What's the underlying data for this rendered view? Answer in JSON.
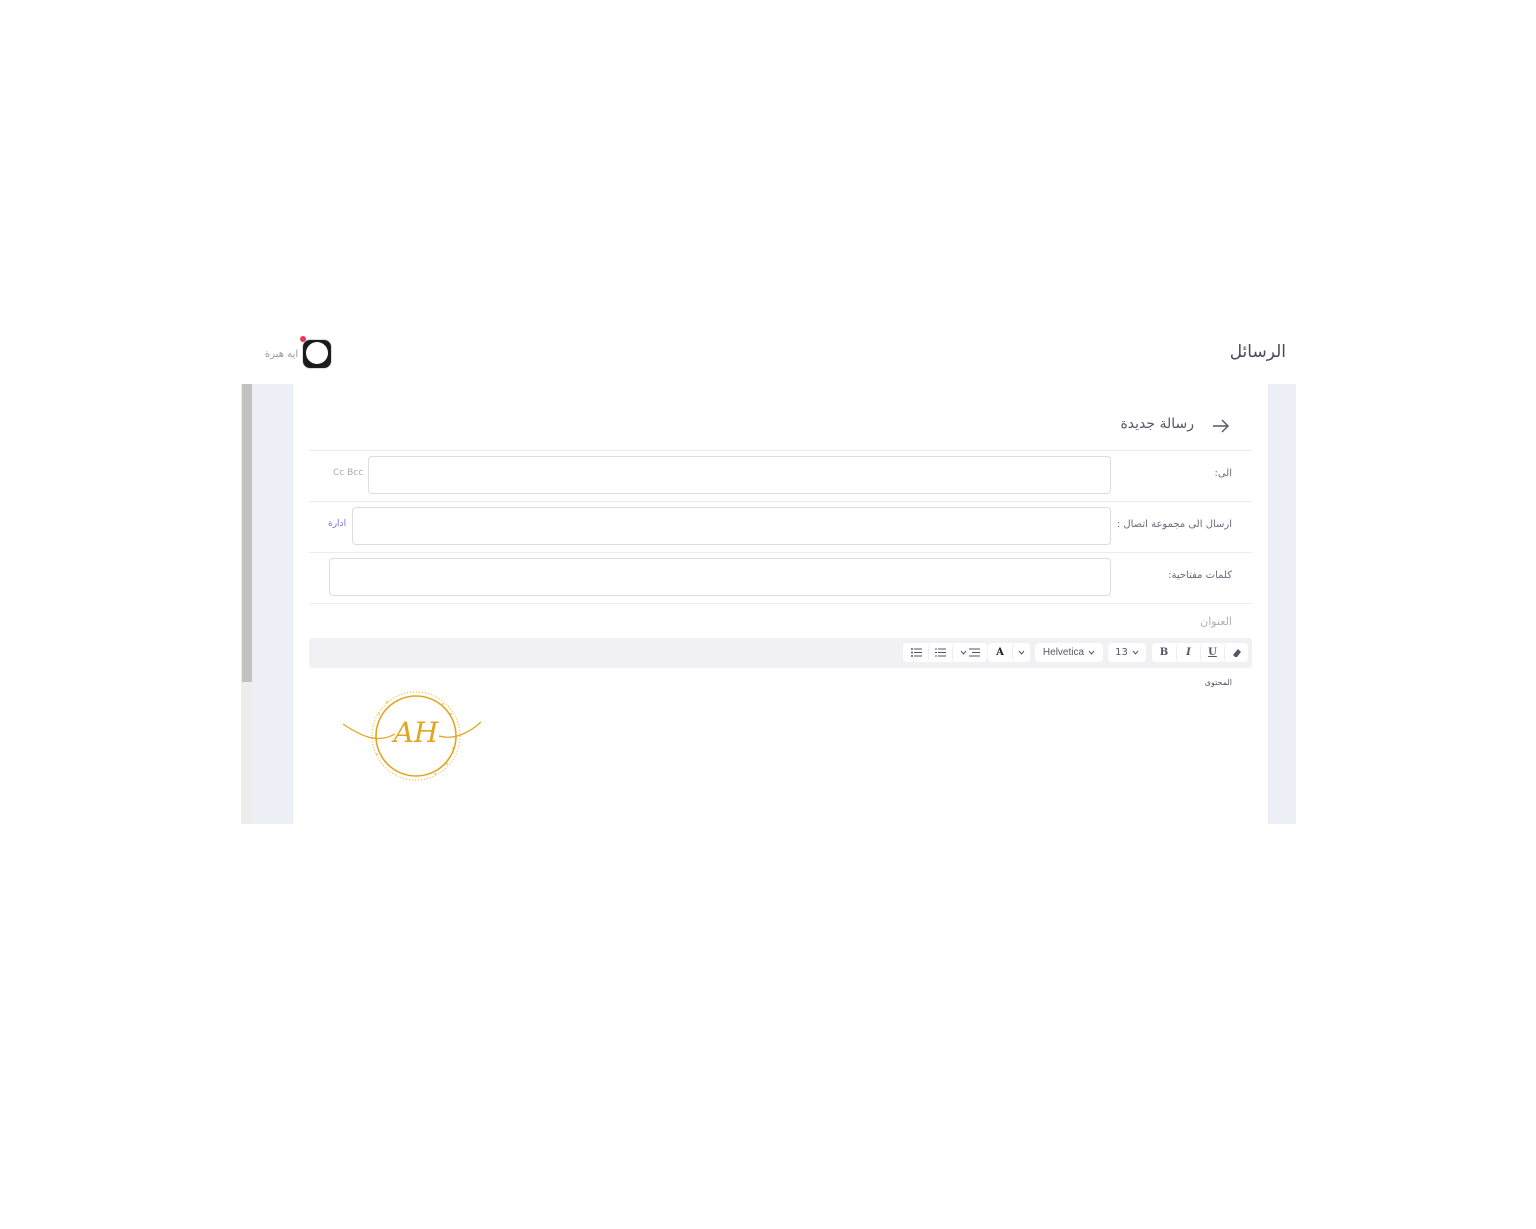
{
  "header": {
    "page_title": "الرسائل",
    "user_name": "ايه هبرة"
  },
  "compose": {
    "title": "رسالة جديدة",
    "to_label": "الى:",
    "cc_bcc": "Cc Bcc",
    "group_label": "ارسال الى مجموعة اتصال :",
    "manage_link": "ادارة",
    "keywords_label": "كلمات مفتاحية:",
    "subject_placeholder": "العنوان",
    "content_label": "المحتوى"
  },
  "toolbar": {
    "bold": "B",
    "italic": "I",
    "underline": "U",
    "font_size": "13",
    "font_family": "Helvetica",
    "color": "A"
  },
  "colors": {
    "accent": "#7b6fd6",
    "logo_gold": "#e2a520",
    "notification": "#f0345a"
  },
  "logo": {
    "monogram": "AH"
  }
}
